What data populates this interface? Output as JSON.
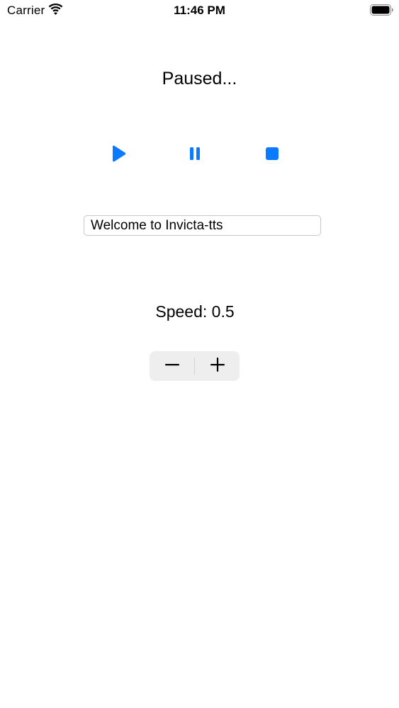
{
  "status_bar": {
    "carrier": "Carrier",
    "time": "11:46 PM",
    "wifi_icon": "wifi-icon",
    "battery_icon": "battery-full-icon"
  },
  "player": {
    "status_text": "Paused...",
    "accent_color": "#0a7aff",
    "controls": {
      "play_icon": "play-icon",
      "pause_icon": "pause-icon",
      "stop_icon": "stop-icon"
    }
  },
  "text_input": {
    "value": "Welcome to Invicta-tts"
  },
  "speed": {
    "label": "Speed: 0.5",
    "stepper": {
      "decrement_icon": "minus-icon",
      "increment_icon": "plus-icon"
    }
  }
}
